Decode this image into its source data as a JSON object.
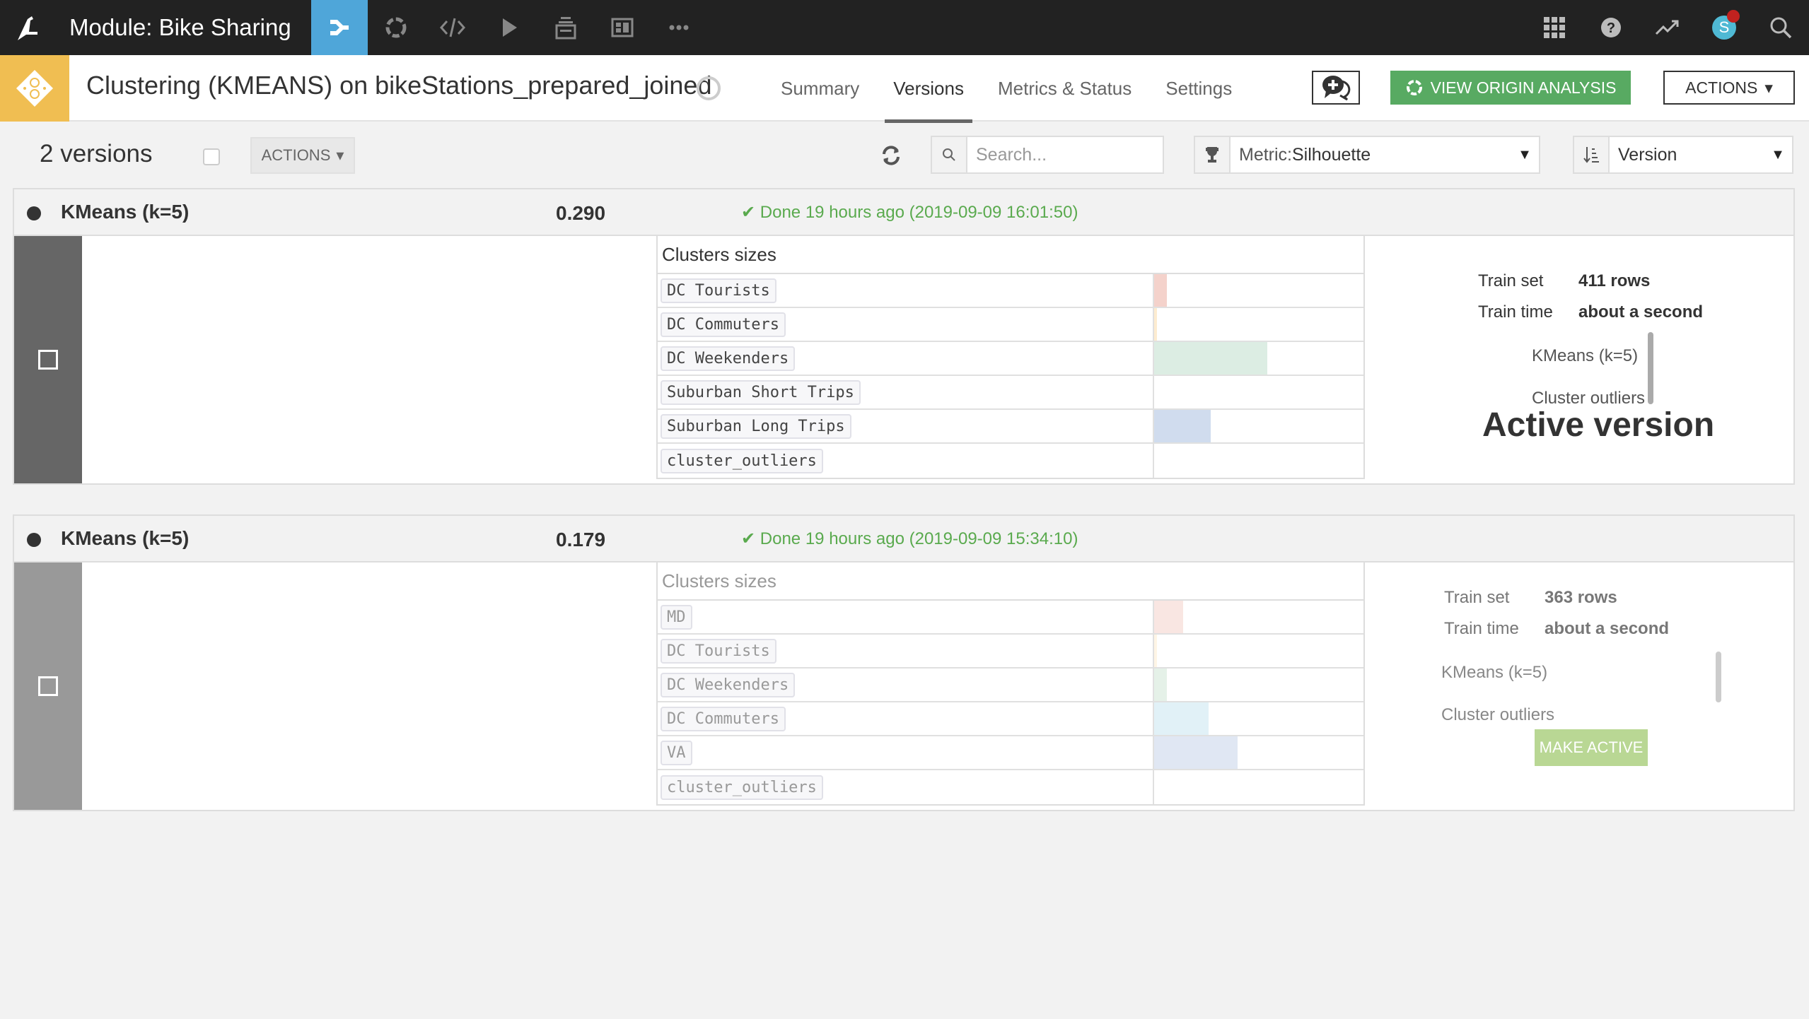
{
  "topbar": {
    "project_title": "Module: Bike Sharing",
    "nav_icons": [
      "flow-icon",
      "lab-icon",
      "code-icon",
      "run-icon",
      "deploy-icon",
      "dashboard-icon",
      "more-icon"
    ],
    "right_icons": [
      "apps-grid-icon",
      "help-icon",
      "activity-icon",
      "avatar",
      "search-icon"
    ],
    "avatar_letter": "S"
  },
  "object": {
    "title": "Clustering (KMEANS) on bikeStations_prepared_joined",
    "tabs": [
      {
        "label": "Summary",
        "active": false
      },
      {
        "label": "Versions",
        "active": true
      },
      {
        "label": "Metrics & Status",
        "active": false
      },
      {
        "label": "Settings",
        "active": false
      }
    ],
    "view_origin_label": "VIEW ORIGIN ANALYSIS",
    "actions_label": "ACTIONS",
    "accent_color": "#f0be52",
    "origin_button_color": "#58aa62"
  },
  "toolbar": {
    "versions_count": "2 versions",
    "actions_label": "ACTIONS",
    "search_placeholder": "Search...",
    "metric_prefix": "Metric: ",
    "metric_value": "Silhouette",
    "sort_value": "Version"
  },
  "versions": [
    {
      "algorithm": "KMeans (k=5)",
      "score": "0.290",
      "status": "Done 19 hours ago (2019-09-09 16:01:50)",
      "active": true,
      "clusters_title": "Clusters sizes",
      "clusters": [
        {
          "name": "DC Tourists",
          "size_fraction": 0.06,
          "color": "#f4d2cb"
        },
        {
          "name": "DC Commuters",
          "size_fraction": 0.013,
          "color": "#fdecd0"
        },
        {
          "name": "DC Weekenders",
          "size_fraction": 0.54,
          "color": "#dcede3"
        },
        {
          "name": "Suburban Short Trips",
          "size_fraction": 0.0,
          "color": "#e6e6e6"
        },
        {
          "name": "Suburban Long Trips",
          "size_fraction": 0.27,
          "color": "#d0dcee"
        },
        {
          "name": "cluster_outliers",
          "size_fraction": 0.0,
          "color": "#e6e6e6"
        }
      ],
      "train_set_label": "Train set",
      "train_set_value": "411 rows",
      "train_time_label": "Train time",
      "train_time_value": "about a second",
      "model_label": "KMeans (k=5)",
      "outliers_label": "Cluster outliers",
      "active_label": "Active version"
    },
    {
      "algorithm": "KMeans (k=5)",
      "score": "0.179",
      "status": "Done 19 hours ago (2019-09-09 15:34:10)",
      "active": false,
      "clusters_title": "Clusters sizes",
      "clusters": [
        {
          "name": "MD",
          "size_fraction": 0.14,
          "color": "#f4d2cb"
        },
        {
          "name": "DC Tourists",
          "size_fraction": 0.013,
          "color": "#fdecd0"
        },
        {
          "name": "DC Weekenders",
          "size_fraction": 0.06,
          "color": "#cfe6d6"
        },
        {
          "name": "DC Commuters",
          "size_fraction": 0.26,
          "color": "#c9e6f0"
        },
        {
          "name": "VA",
          "size_fraction": 0.4,
          "color": "#c6d3ea"
        },
        {
          "name": "cluster_outliers",
          "size_fraction": 0.0,
          "color": "#e6e6e6"
        }
      ],
      "train_set_label": "Train set",
      "train_set_value": "363 rows",
      "train_time_label": "Train time",
      "train_time_value": "about a second",
      "model_label": "KMeans (k=5)",
      "outliers_label": "Cluster outliers",
      "make_active_label": "MAKE ACTIVE"
    }
  ]
}
